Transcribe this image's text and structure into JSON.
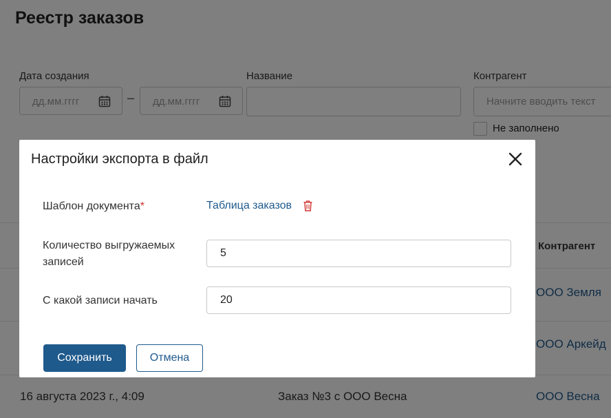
{
  "page": {
    "title": "Реестр заказов",
    "filters": {
      "date_label": "Дата создания",
      "date_from_placeholder": "дд.мм.гггг",
      "date_to_placeholder": "дд.мм.гггг",
      "date_separator": "–",
      "name_label": "Название",
      "counterparty_label": "Контрагент",
      "counterparty_placeholder": "Начните вводить текст",
      "not_filled_label": "Не заполнено"
    },
    "table": {
      "counterparty_header": "Контрагент",
      "rows": [
        {
          "counterparty": "ООО Земля"
        },
        {
          "counterparty": "ООО Аркейд"
        },
        {
          "date": "16 августа 2023 г., 4:09",
          "name": "Заказ №3 с ООО Весна",
          "counterparty": "ООО Весна"
        }
      ]
    }
  },
  "modal": {
    "title": "Настройки экспорта в файл",
    "template_label": "Шаблон документа",
    "required_mark": "*",
    "template_value": "Таблица заказов",
    "count_label": "Количество выгружаемых записей",
    "count_value": "5",
    "start_label": "С какой записи начать",
    "start_value": "20",
    "save_label": "Сохранить",
    "cancel_label": "Отмена"
  },
  "colors": {
    "accent": "#1f5a8c",
    "required": "#d0312d",
    "overlay": "rgba(0,0,0,0.5)"
  }
}
